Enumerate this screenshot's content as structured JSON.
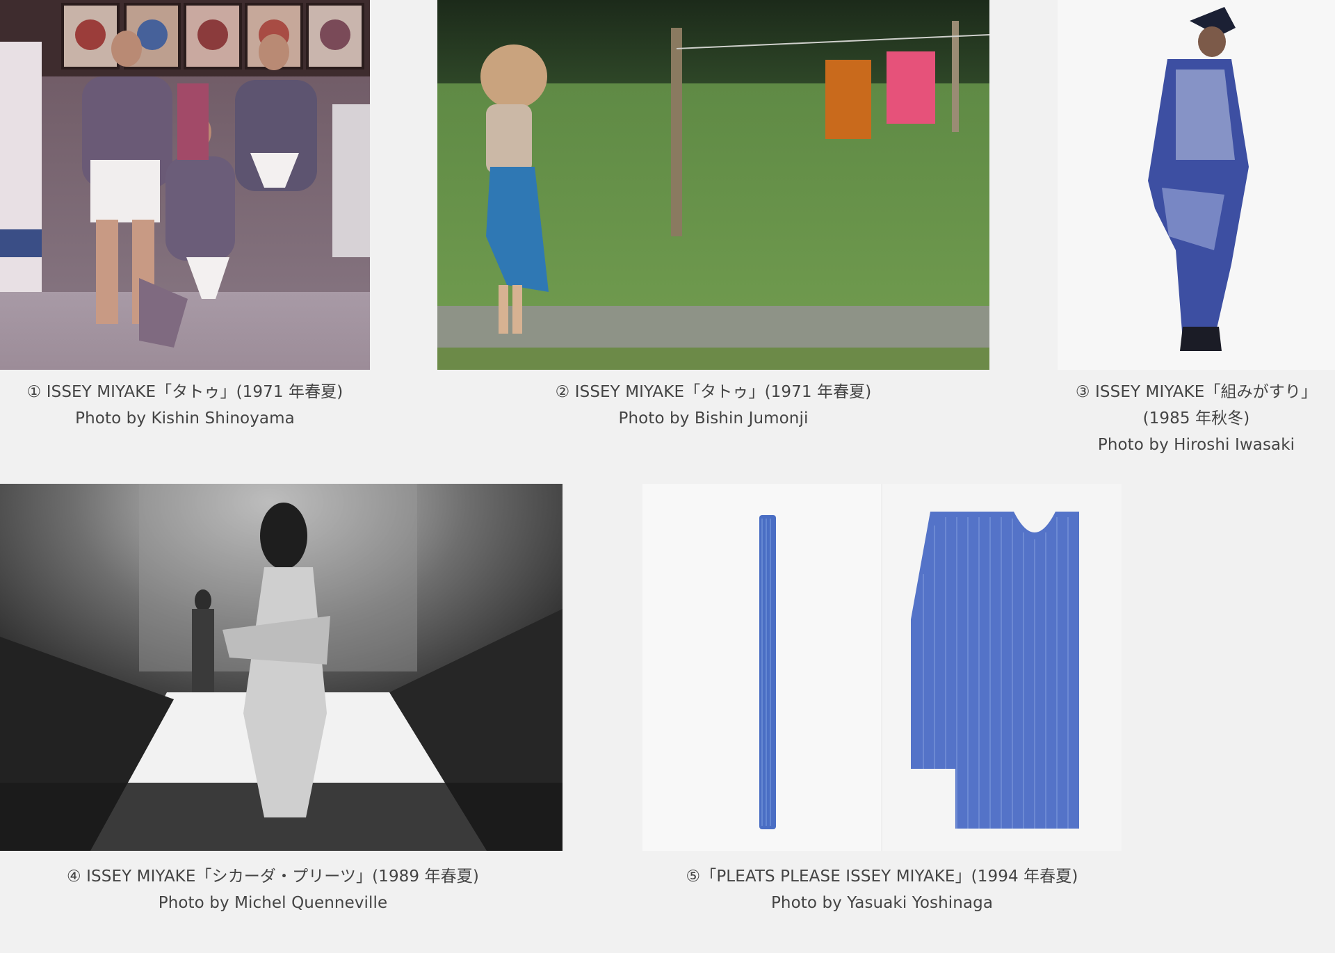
{
  "gallery": {
    "items": [
      {
        "title": "① ISSEY MIYAKE「タトゥ」(1971 年春夏)",
        "credit": "Photo by Kishin Shinoyama"
      },
      {
        "title": "② ISSEY MIYAKE「タトゥ」(1971 年春夏)",
        "credit": "Photo by Bishin Jumonji"
      },
      {
        "title": "③ ISSEY MIYAKE「組みがすり」",
        "title_line2": "(1985 年秋冬)",
        "credit": "Photo by Hiroshi Iwasaki"
      },
      {
        "title": "④ ISSEY MIYAKE「シカーダ・プリーツ」(1989 年春夏)",
        "credit": "Photo by Michel Quenneville"
      },
      {
        "title": "⑤「PLEATS PLEASE ISSEY MIYAKE」(1994 年春夏)",
        "credit": "Photo by Yasuaki Yoshinaga"
      }
    ]
  }
}
